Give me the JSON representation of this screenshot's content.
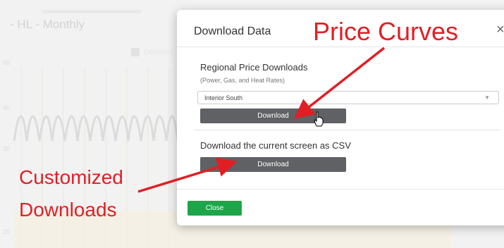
{
  "background": {
    "title": "- HL - Monthly",
    "legend_label": "Demand",
    "axis_labels": [
      "50",
      "40",
      "30",
      "20"
    ]
  },
  "modal": {
    "title": "Download Data",
    "close_glyph": "×",
    "regional": {
      "heading": "Regional Price Downloads",
      "subheading": "(Power, Gas, and Heat Rates)",
      "selected_region": "Interior South",
      "download_label": "Download"
    },
    "csv": {
      "heading": "Download the current screen as CSV",
      "download_label": "Download"
    },
    "close_label": "Close"
  },
  "annotations": {
    "price_curves": "Price Curves",
    "customized_line1": "Customized",
    "customized_line2": "Downloads",
    "color": "#e01f25"
  },
  "icons": {
    "select_caret": "chevron-down-icon",
    "cursor": "hand-pointer-icon"
  }
}
